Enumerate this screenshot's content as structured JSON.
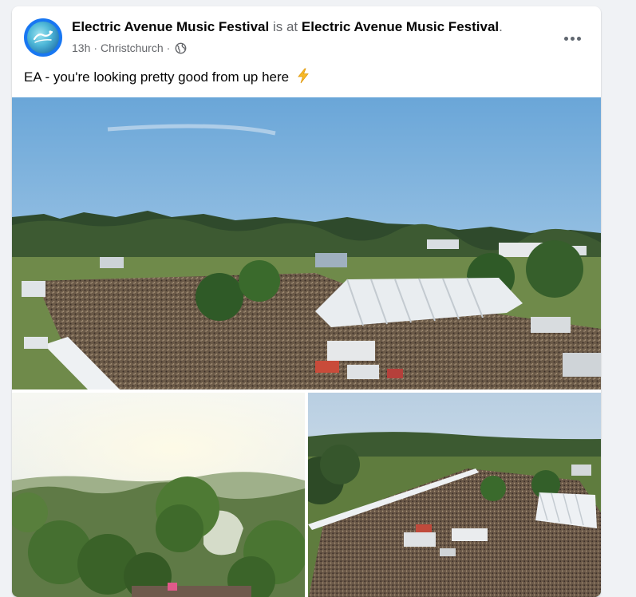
{
  "post": {
    "page_name": "Electric Avenue Music Festival",
    "is_at_text": "is at",
    "location_name": "Electric Avenue Music Festival",
    "period": ".",
    "time_ago": "13h",
    "separator": "·",
    "city": "Christchurch",
    "separator2": "·",
    "audience_icon": "globe-icon",
    "caption": "EA - you're looking pretty good from up here",
    "caption_emoji": "lightning-bolt-icon",
    "more_icon": "more-horizontal-icon"
  },
  "photos": [
    {
      "name": "aerial-festival-crowd-main"
    },
    {
      "name": "aerial-park-trees-sun"
    },
    {
      "name": "aerial-festival-crowd-stages"
    }
  ],
  "colors": {
    "background": "#f0f2f5",
    "card": "#ffffff",
    "text_primary": "#050505",
    "text_secondary": "#65676b",
    "brand_blue": "#1877f2",
    "bolt_yellow": "#f7b928"
  }
}
